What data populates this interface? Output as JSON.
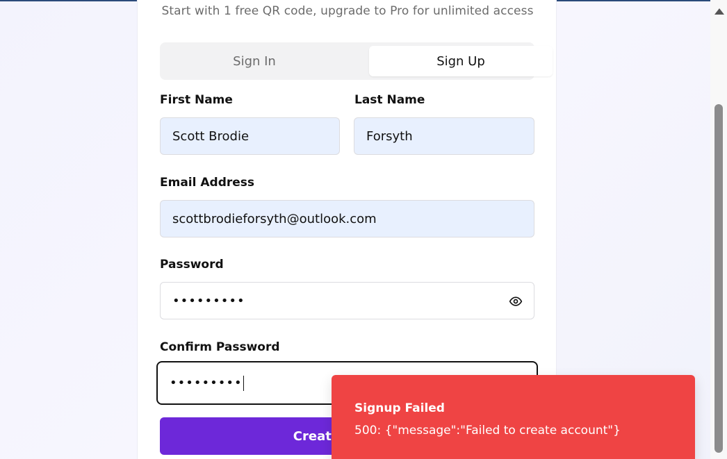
{
  "header": {
    "subtitle": "Start with 1 free QR code, upgrade to Pro for unlimited access"
  },
  "tabs": [
    {
      "label": "Sign In",
      "active": false
    },
    {
      "label": "Sign Up",
      "active": true
    }
  ],
  "form": {
    "first_name": {
      "label": "First Name",
      "value": "Scott Brodie"
    },
    "last_name": {
      "label": "Last Name",
      "value": "Forsyth"
    },
    "email": {
      "label": "Email Address",
      "value": "scottbrodieforsyth@outlook.com"
    },
    "password": {
      "label": "Password",
      "masked_value": "•••••••••",
      "toggle_icon": "eye-icon"
    },
    "confirm_password": {
      "label": "Confirm Password",
      "masked_value": "•••••••••"
    },
    "submit_label": "Create Account"
  },
  "toast": {
    "title": "Signup Failed",
    "message": "500: {\"message\":\"Failed to create account\"}",
    "color": "#ef4444"
  },
  "theme": {
    "accent": "#6d28d9"
  }
}
